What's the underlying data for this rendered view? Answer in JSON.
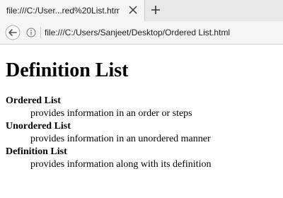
{
  "browser": {
    "tab_title": "file:///C:/User...red%20List.html",
    "url": "file:///C:/Users/Sanjeet/Desktop/Ordered List.html"
  },
  "page": {
    "title": "Definition List",
    "items": [
      {
        "term": "Ordered List",
        "description": "provides information in an order or steps"
      },
      {
        "term": "Unordered List",
        "description": "provides information in an unordered manner"
      },
      {
        "term": "Definition List",
        "description": "provides information along with its definition"
      }
    ]
  }
}
